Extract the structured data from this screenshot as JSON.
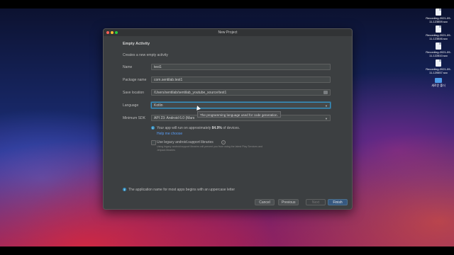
{
  "desktop": {
    "items": [
      {
        "label": "Recording-2021-09-11-123859.scc",
        "type": "file"
      },
      {
        "label": "Recording-2021-09-11-123846.scc",
        "type": "file"
      },
      {
        "label": "Recording-2021-09-11-122810.scc",
        "type": "file"
      },
      {
        "label": "Recording-2021-09-11-120657.scc",
        "type": "file"
      },
      {
        "label": "새로운 폴더",
        "type": "folder"
      }
    ]
  },
  "window": {
    "title": "New Project",
    "section_title": "Empty Activity",
    "subtitle": "Creates a new empty activity",
    "fields": {
      "name": {
        "label": "Name",
        "value": "test1"
      },
      "package": {
        "label": "Package name",
        "value": "com.sentilab.test1"
      },
      "save_location": {
        "label": "Save location",
        "value": "/Users/sentilab/sentilab_youtube_source/test1"
      },
      "language": {
        "label": "Language",
        "value": "Kotlin"
      },
      "min_sdk": {
        "label": "Minimum SDK",
        "value": "API 23: Android 6.0 (Mars"
      }
    },
    "tooltip": "The programming language used for code generation.",
    "info": {
      "prefix": "Your app will run on approximately",
      "percent": "84.9%",
      "suffix": "of devices.",
      "help_link": "Help me choose"
    },
    "legacy": {
      "label": "Use legacy android.support libraries",
      "description": "Using legacy android.support libraries will prevent you from using the latest Play Services and Jetpack libraries"
    },
    "hint": "The application name for most apps begins with an uppercase letter",
    "buttons": {
      "cancel": "Cancel",
      "previous": "Previous",
      "next": "Next",
      "finish": "Finish"
    }
  },
  "colors": {
    "accent": "#3592c4",
    "dialog_bg": "#3c3f41",
    "primary_button": "#365880"
  }
}
